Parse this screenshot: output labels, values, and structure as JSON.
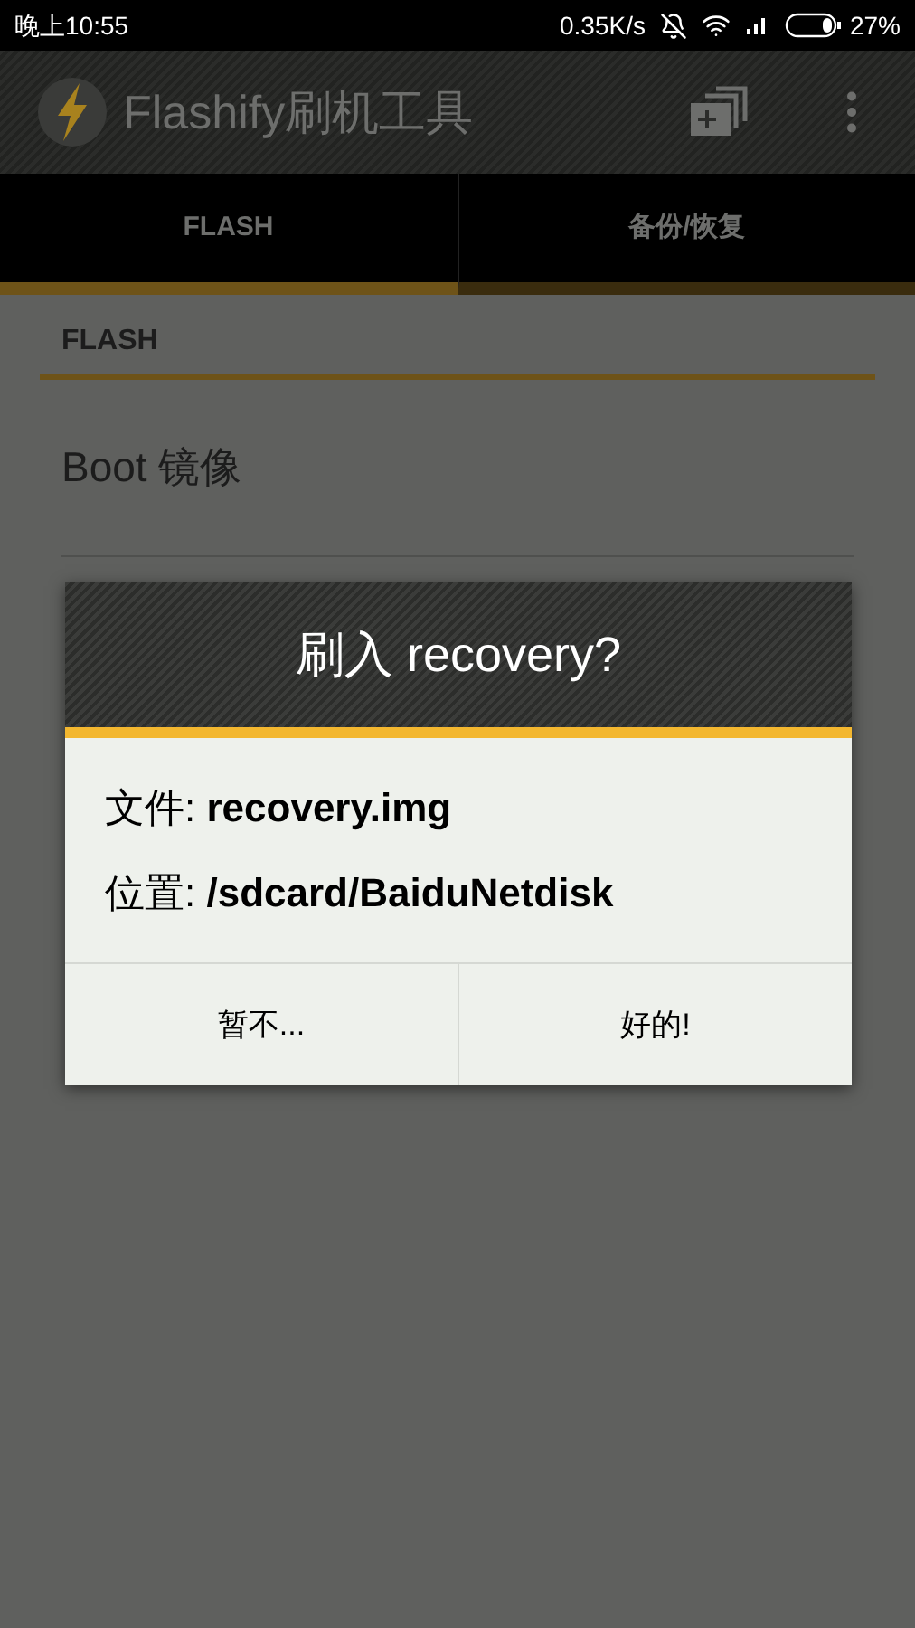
{
  "status_bar": {
    "time": "晚上10:55",
    "speed": "0.35K/s",
    "battery": "27%"
  },
  "app_bar": {
    "title": "Flashify刷机工具"
  },
  "tabs": [
    {
      "label": "FLASH",
      "selected": true
    },
    {
      "label": "备份/恢复",
      "selected": false
    }
  ],
  "section": {
    "header": "FLASH",
    "items": [
      "Boot 镜像"
    ]
  },
  "dialog": {
    "title": "刷入 recovery?",
    "lines": [
      "文件: **recovery.img**",
      "位置: **/sdcard/BaiduNetdisk**"
    ],
    "buttons": [
      "暂不...",
      "好的!"
    ]
  }
}
